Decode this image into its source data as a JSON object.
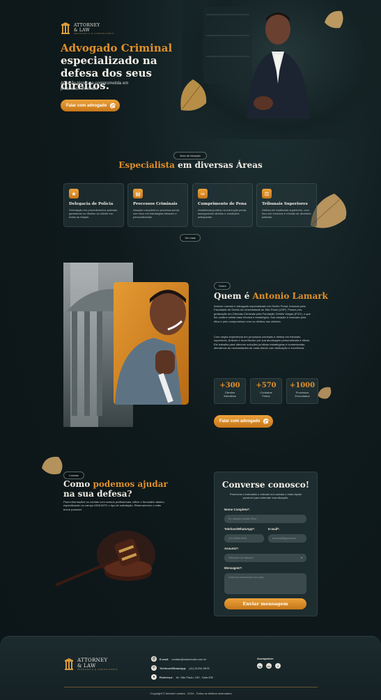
{
  "brand": {
    "name_line1": "ATTORNEY",
    "name_line2": "& LAW",
    "tagline": "ADVOCACIA E CONSULTORIA"
  },
  "hero": {
    "title_accent": "Advogado Criminal",
    "title_rest": "especializado na defesa dos seus direitos.",
    "subtitle": "Atuação técnica e comprometida em processos criminais.",
    "cta_label": "Falar com advogado"
  },
  "areas": {
    "pill": "Área de Atuação",
    "title_accent": "Especialista",
    "title_rest": " em diversas Áreas",
    "more_label": "Ver mais",
    "cards": [
      {
        "icon": "police-badge-icon",
        "glyph": "★",
        "title": "Delegacia de Polícia",
        "text": "Orientação em procedimentos policiais, garantindo os direitos do cliente em todas as etapas."
      },
      {
        "icon": "document-icon",
        "glyph": "▤",
        "title": "Processos Criminais",
        "text": "Atuação completa no processo penal, com foco em estratégias eficazes e personalizadas."
      },
      {
        "icon": "handcuffs-icon",
        "glyph": "∞",
        "title": "Cumprimento de Pena",
        "text": "Assistência jurídica na execução penal, assegurando direitos e condições adequadas."
      },
      {
        "icon": "gavel-icon",
        "glyph": "⚖",
        "title": "Tribunais Superiores",
        "text": "Defesa em instâncias superiores, com foco em recursos e revisão de decisões judiciais."
      }
    ]
  },
  "about": {
    "pill": "Sobre",
    "title_pre": "Quem é ",
    "title_accent": "Antonio Lamark",
    "para1": "Antonio Lamark é advogado especializado em Direito Penal, formado pela Faculdade de Direito da Universidade de São Paulo (USP). Possui pós-graduação em Ciências Criminais pela Fundação Getúlio Vargas (FGV), o que lhe confere sólida base técnica e estratégica. Sua atuação é marcada pela ética e pelo compromisso com os direitos dos clientes.",
    "para2": "Com ampla experiência em processos criminais e defesa em tribunais superiores, Antonio é reconhecido por sua abordagem personalizada e eficaz. Ele trabalha para oferecer soluções jurídicas estratégicas e humanizadas, atendendo às necessidades de cada cliente com dedicação e excelência.",
    "stats": [
      {
        "num": "+300",
        "label": "Clientes Atendidos"
      },
      {
        "num": "+570",
        "label": "Contratos Feitos"
      },
      {
        "num": "+1000",
        "label": "Processos Executados"
      }
    ],
    "cta_label": "Falar com advogado"
  },
  "contact": {
    "pill": "Contato",
    "title_pre": "Como ",
    "title_accent": "podemos ajudar",
    "title_post": " na sua defesa?",
    "text": "Para informações ou contato com nossos profissionais, utilize o formulário abaixo, especificando no campo ASSUNTO o tipo de solicitação. Retornaremos o mais breve possível."
  },
  "form": {
    "title": "Converse conosco!",
    "subtitle": "Preencha o formulário e entrarei em contato o mais rápido possível para entender sua situação.",
    "name_label": "Nome Completo*:",
    "name_placeholder": "Ex: Antonio Lamark Silva",
    "phone_label": "Telefone/WhatsApp*:",
    "phone_placeholder": "(11) 99999-9999",
    "email_label": "E-mail*:",
    "email_placeholder": "seuemail@gmail.com",
    "subject_label": "Assunto*:",
    "subject_placeholder": "Selecione um assunto",
    "message_label": "Mensagem*:",
    "message_placeholder": "Descreva brevemente seu caso...",
    "submit_label": "Enviar mensagem"
  },
  "footer": {
    "email_label": "E-mail:",
    "email_value": "contato@antonioadv.com.br",
    "phone_label": "Telefone/WhatsApp:",
    "phone_value": "(11) 91234-5678",
    "address_label": "Endereço:",
    "address_value": "Av. São Paulo, 100 - Sala 205",
    "social_title": "Acompanhe:",
    "socials": [
      "ig",
      "in",
      "f"
    ],
    "copyright": "Copyright © Antonio Lamark - 2024 - Todos os direitos reservados"
  },
  "colors": {
    "accent": "#e0902a",
    "background": "#0f1a1c",
    "card": "#28383c"
  }
}
